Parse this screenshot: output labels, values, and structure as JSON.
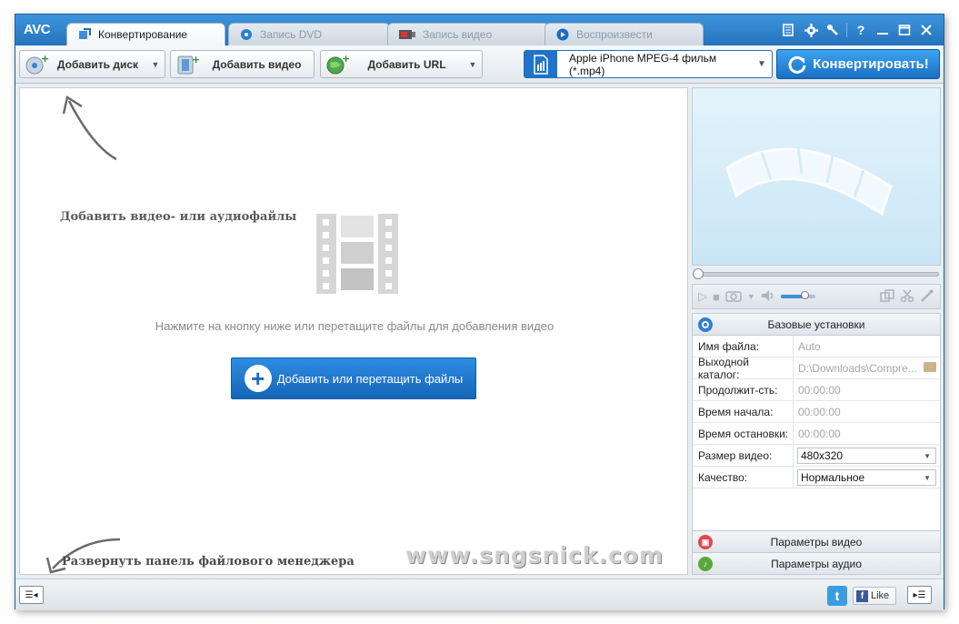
{
  "app": {
    "logo": "AVC"
  },
  "tabs": [
    {
      "label": "Конвертирование",
      "active": true,
      "icon": "convert-icon"
    },
    {
      "label": "Запись DVD",
      "active": false,
      "icon": "disc-icon"
    },
    {
      "label": "Запись видео",
      "active": false,
      "icon": "record-icon"
    },
    {
      "label": "Воспроизвести",
      "active": false,
      "icon": "play-icon"
    }
  ],
  "window_controls": [
    "skin-icon",
    "settings-icon",
    "tools-icon",
    "help-icon",
    "minimize-icon",
    "maximize-icon",
    "close-icon"
  ],
  "window_labels": {
    "help": "?"
  },
  "toolbar": {
    "add_disc": "Добавить диск",
    "add_video": "Добавить видео",
    "add_url": "Добавить URL",
    "profile": "Apple iPhone MPEG-4 фильм (*.mp4)",
    "convert": "Конвертировать!"
  },
  "filearea": {
    "heading": "Добавить видео- или аудиофайлы",
    "hint": "Нажмите на кнопку ниже или перетащите файлы для добавления видео",
    "add_button": "Добавить или перетащить файлы",
    "expand_text": "Развернуть панель файлового менеджера",
    "watermark": "www.sngsnick.com"
  },
  "player": {
    "volume_fraction": 0.7,
    "seek_fraction": 0.0
  },
  "settings": {
    "header": "Базовые установки",
    "rows": [
      {
        "key": "Имя файла:",
        "value": "Auto",
        "type": "text"
      },
      {
        "key": "Выходной каталог:",
        "value": "D:\\Downloads\\Compre...",
        "type": "folder"
      },
      {
        "key": "Продолжит-сть:",
        "value": "00:00:00",
        "type": "text"
      },
      {
        "key": "Время начала:",
        "value": "00:00:00",
        "type": "text"
      },
      {
        "key": "Время остановки:",
        "value": "00:00:00",
        "type": "text"
      },
      {
        "key": "Размер видео:",
        "value": "480x320",
        "type": "select"
      },
      {
        "key": "Качество:",
        "value": "Нормальное",
        "type": "select"
      }
    ],
    "video_params": "Параметры видео",
    "audio_params": "Параметры аудио"
  },
  "statusbar": {
    "like": "Like",
    "twitter": "t",
    "facebook": "f"
  },
  "colors": {
    "accent": "#2b82cc",
    "button_blue": "#1a6fc2",
    "watermark": "#cfcfcf"
  }
}
